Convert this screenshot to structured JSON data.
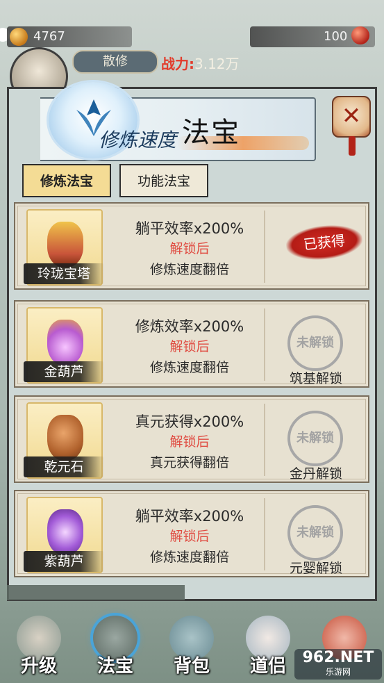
{
  "hud": {
    "coins": "4767",
    "gems": "100",
    "rank": "散修",
    "power_label": "战力:",
    "power_value": "3.12万"
  },
  "dialog": {
    "title": "法宝",
    "subtitle": "修炼速度",
    "tabs": [
      {
        "label": "修炼法宝",
        "active": true
      },
      {
        "label": "功能法宝",
        "active": false
      }
    ],
    "close_icon": "close-icon"
  },
  "items": [
    {
      "name": "玲珑宝塔",
      "line1": "躺平效率x200%",
      "line2": "解锁后",
      "line3": "修炼速度翻倍",
      "status": "已获得",
      "unlock_req": "",
      "color": "#c9553a"
    },
    {
      "name": "金葫芦",
      "line1": "修炼效率x200%",
      "line2": "解锁后",
      "line3": "修炼速度翻倍",
      "status": "未解锁",
      "unlock_req": "筑基解锁",
      "color": "#b85bd0"
    },
    {
      "name": "乾元石",
      "line1": "真元获得x200%",
      "line2": "解锁后",
      "line3": "真元获得翻倍",
      "status": "未解锁",
      "unlock_req": "金丹解锁",
      "color": "#b0612c"
    },
    {
      "name": "紫葫芦",
      "line1": "躺平效率x200%",
      "line2": "解锁后",
      "line3": "修炼速度翻倍",
      "status": "未解锁",
      "unlock_req": "元婴解锁",
      "color": "#a35cd8"
    }
  ],
  "nav": [
    {
      "label": "升级",
      "active": false,
      "color": "#8e9c94"
    },
    {
      "label": "法宝",
      "active": true,
      "color": "#5c6a63"
    },
    {
      "label": "背包",
      "active": false,
      "color": "#6a8b93"
    },
    {
      "label": "道侣",
      "active": false,
      "color": "#a7b7c2"
    },
    {
      "label": "",
      "active": false,
      "color": "#c6523c"
    }
  ],
  "watermark": {
    "main": "962.NET",
    "sub": "乐游网"
  }
}
